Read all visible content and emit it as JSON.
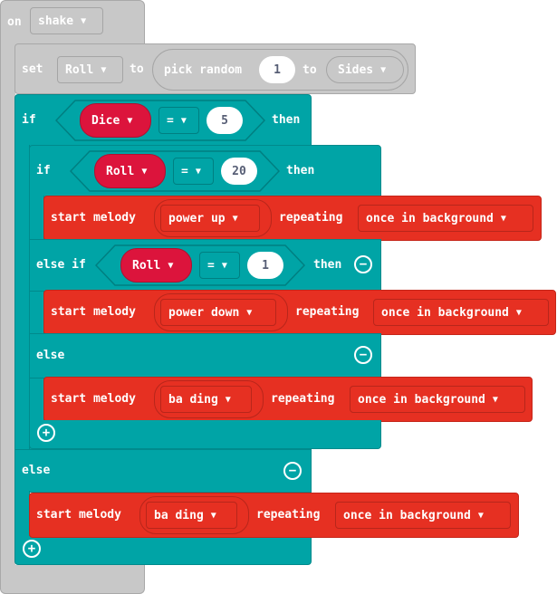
{
  "event_block": {
    "on_label": "on",
    "event_value": "shake"
  },
  "set_block": {
    "set_label": "set",
    "variable": "Roll",
    "to_label": "to",
    "pick_random_label": "pick random",
    "from_value": "1",
    "to_label2": "to",
    "to_value": "Sides"
  },
  "if_outer": {
    "if_label": "if",
    "variable": "Dice",
    "operator": "=",
    "compare_value": "5",
    "then_label": "then"
  },
  "if_inner": {
    "if_label": "if",
    "variable": "Roll",
    "operator": "=",
    "compare_value": "20",
    "then_label": "then",
    "melody1": {
      "start_label": "start melody",
      "melody": "power up",
      "repeating_label": "repeating",
      "mode": "once in background"
    },
    "elseif_label": "else if",
    "elseif_variable": "Roll",
    "elseif_operator": "=",
    "elseif_value": "1",
    "elseif_then": "then",
    "melody2": {
      "start_label": "start melody",
      "melody": "power down",
      "repeating_label": "repeating",
      "mode": "once in background"
    },
    "else_label": "else",
    "melody3": {
      "start_label": "start melody",
      "melody": "ba ding",
      "repeating_label": "repeating",
      "mode": "once in background"
    }
  },
  "outer_else": {
    "else_label": "else",
    "melody": {
      "start_label": "start melody",
      "melody": "ba ding",
      "repeating_label": "repeating",
      "mode": "once in background"
    }
  },
  "icons": {
    "dropdown": "▼",
    "minus": "−",
    "plus": "+"
  },
  "colors": {
    "event": "#c8c8c8",
    "logic": "#00a4a6",
    "music": "#e63022",
    "variable": "#dc143c"
  }
}
